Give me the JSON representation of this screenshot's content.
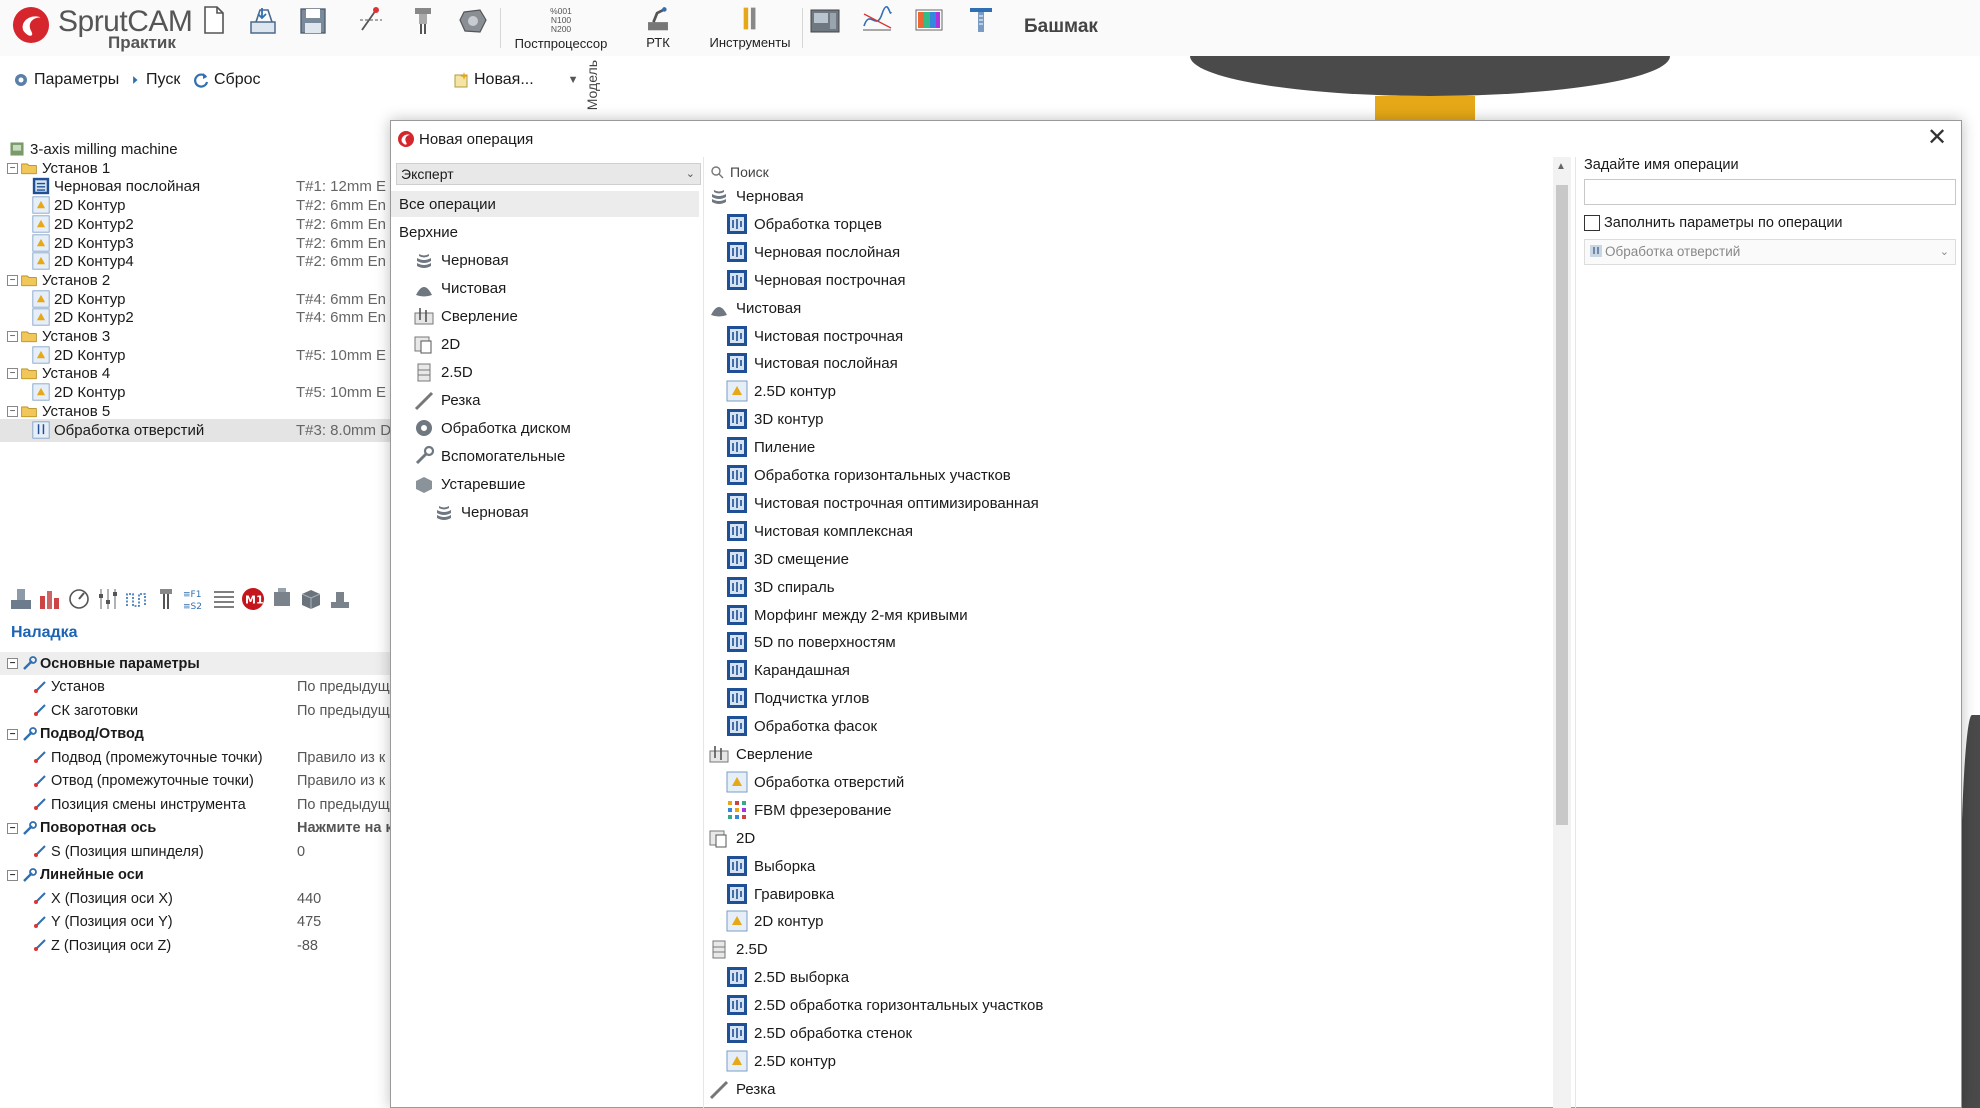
{
  "toolbar": {
    "logo_text": "SprutCAM",
    "logo_sub": "Практик",
    "buttons": [
      {
        "id": "new-file",
        "label": ""
      },
      {
        "id": "open-file",
        "label": ""
      },
      {
        "id": "save-file",
        "label": ""
      },
      {
        "id": "cut-tool",
        "label": ""
      },
      {
        "id": "tool-holder",
        "label": ""
      },
      {
        "id": "part",
        "label": ""
      },
      {
        "id": "postprocessor",
        "label": "Постпроцессор"
      },
      {
        "id": "rtk",
        "label": "РТК"
      },
      {
        "id": "tools",
        "label": "Инструменты"
      },
      {
        "id": "machine",
        "label": ""
      },
      {
        "id": "graph",
        "label": ""
      },
      {
        "id": "palette",
        "label": ""
      },
      {
        "id": "measure",
        "label": ""
      }
    ],
    "postprocessor_label": "Постпроцессор",
    "postprocessor_codes": [
      "%001",
      "N100",
      "N200"
    ],
    "rtk_label": "РТК",
    "tools_label": "Инструменты",
    "project_title": "Башмак"
  },
  "left_panel": {
    "actions": {
      "params": "Параметры",
      "run": "Пуск",
      "reset": "Сброс",
      "new": "Новая..."
    },
    "side_tab": "Модель",
    "tree": [
      {
        "level": 0,
        "type": "machine",
        "label": "3-axis milling machine",
        "tool": ""
      },
      {
        "level": 0,
        "type": "setup",
        "label": "Установ 1",
        "tool": ""
      },
      {
        "level": 1,
        "type": "op-rough",
        "label": "Черновая послойная",
        "tool": "T#1: 12mm E"
      },
      {
        "level": 1,
        "type": "op-2d",
        "label": "2D Контур",
        "tool": "T#2: 6mm En"
      },
      {
        "level": 1,
        "type": "op-2d",
        "label": "2D Контур2",
        "tool": "T#2: 6mm En"
      },
      {
        "level": 1,
        "type": "op-2d",
        "label": "2D Контур3",
        "tool": "T#2: 6mm En"
      },
      {
        "level": 1,
        "type": "op-2d",
        "label": "2D Контур4",
        "tool": "T#2: 6mm En"
      },
      {
        "level": 0,
        "type": "setup",
        "label": "Установ 2",
        "tool": ""
      },
      {
        "level": 1,
        "type": "op-2d",
        "label": "2D Контур",
        "tool": "T#4: 6mm En"
      },
      {
        "level": 1,
        "type": "op-2d",
        "label": "2D Контур2",
        "tool": "T#4: 6mm En"
      },
      {
        "level": 0,
        "type": "setup",
        "label": "Установ 3",
        "tool": ""
      },
      {
        "level": 1,
        "type": "op-2d",
        "label": "2D Контур",
        "tool": "T#5: 10mm E"
      },
      {
        "level": 0,
        "type": "setup",
        "label": "Установ 4",
        "tool": ""
      },
      {
        "level": 1,
        "type": "op-2d",
        "label": "2D Контур",
        "tool": "T#5: 10mm E"
      },
      {
        "level": 0,
        "type": "setup",
        "label": "Установ 5",
        "tool": ""
      },
      {
        "level": 1,
        "type": "op-drill",
        "label": "Обработка отверстий",
        "tool": "T#3: 8.0mm D",
        "selected": true
      }
    ],
    "props_header": "Наладка",
    "props": [
      {
        "group": true,
        "label": "Основные параметры",
        "value": ""
      },
      {
        "group": false,
        "label": "Установ",
        "value": "По предыдущ"
      },
      {
        "group": false,
        "label": "СК заготовки",
        "value": "По предыдущ"
      },
      {
        "group": true,
        "label": "Подвод/Отвод",
        "value": ""
      },
      {
        "group": false,
        "label": "Подвод (промежуточные точки)",
        "value": "Правило из к"
      },
      {
        "group": false,
        "label": "Отвод (промежуточные точки)",
        "value": "Правило из к"
      },
      {
        "group": false,
        "label": "Позиция смены инструмента",
        "value": "По предыдущ"
      },
      {
        "group": true,
        "label": "Поворотная ось",
        "value": "Нажмите на к"
      },
      {
        "group": false,
        "label": "S (Позиция шпинделя)",
        "value": "0"
      },
      {
        "group": true,
        "label": "Линейные оси",
        "value": ""
      },
      {
        "group": false,
        "label": "X (Позиция оси X)",
        "value": "440"
      },
      {
        "group": false,
        "label": "Y (Позиция оси Y)",
        "value": "475"
      },
      {
        "group": false,
        "label": "Z (Позиция оси Z)",
        "value": "-88"
      }
    ],
    "m1_badge": "M1"
  },
  "dialog": {
    "title": "Новая операция",
    "close": "✕",
    "mode_select": "Эксперт",
    "categories": [
      {
        "level": 0,
        "icon": "",
        "label": "Все операции",
        "selected": true
      },
      {
        "level": 0,
        "icon": "",
        "label": "Верхние"
      },
      {
        "level": 1,
        "icon": "rough",
        "label": "Черновая"
      },
      {
        "level": 1,
        "icon": "finish",
        "label": "Чистовая"
      },
      {
        "level": 1,
        "icon": "drill",
        "label": "Сверление"
      },
      {
        "level": 1,
        "icon": "2d",
        "label": "2D"
      },
      {
        "level": 1,
        "icon": "25d",
        "label": "2.5D"
      },
      {
        "level": 1,
        "icon": "cut",
        "label": "Резка"
      },
      {
        "level": 1,
        "icon": "disk",
        "label": "Обработка диском"
      },
      {
        "level": 1,
        "icon": "aux",
        "label": "Вспомогательные"
      },
      {
        "level": 1,
        "icon": "old",
        "label": "Устаревшие"
      },
      {
        "level": 2,
        "icon": "rough",
        "label": "Черновая"
      }
    ],
    "search_placeholder": "Поиск",
    "operations": [
      {
        "group": true,
        "icon": "rough",
        "label": "Черновая"
      },
      {
        "group": false,
        "icon": "op-blue",
        "label": "Обработка торцев"
      },
      {
        "group": false,
        "icon": "op-blue",
        "label": "Черновая послойная"
      },
      {
        "group": false,
        "icon": "op-blue",
        "label": "Черновая построчная"
      },
      {
        "group": true,
        "icon": "finish",
        "label": "Чистовая"
      },
      {
        "group": false,
        "icon": "op-blue",
        "label": "Чистовая построчная"
      },
      {
        "group": false,
        "icon": "op-blue",
        "label": "Чистовая послойная"
      },
      {
        "group": false,
        "icon": "op-light",
        "label": "2.5D контур"
      },
      {
        "group": false,
        "icon": "op-blue",
        "label": "3D контур"
      },
      {
        "group": false,
        "icon": "op-blue",
        "label": "Пиление"
      },
      {
        "group": false,
        "icon": "op-blue",
        "label": "Обработка горизонтальных участков"
      },
      {
        "group": false,
        "icon": "op-blue",
        "label": "Чистовая построчная оптимизированная"
      },
      {
        "group": false,
        "icon": "op-blue",
        "label": "Чистовая комплексная"
      },
      {
        "group": false,
        "icon": "op-blue",
        "label": "3D смещение"
      },
      {
        "group": false,
        "icon": "op-blue",
        "label": "3D спираль"
      },
      {
        "group": false,
        "icon": "op-blue",
        "label": "Морфинг между 2-мя кривыми"
      },
      {
        "group": false,
        "icon": "op-blue",
        "label": "5D по поверхностям"
      },
      {
        "group": false,
        "icon": "op-blue",
        "label": "Карандашная"
      },
      {
        "group": false,
        "icon": "op-blue",
        "label": "Подчистка углов"
      },
      {
        "group": false,
        "icon": "op-blue",
        "label": "Обработка фасок"
      },
      {
        "group": true,
        "icon": "drill",
        "label": "Сверление"
      },
      {
        "group": false,
        "icon": "op-light",
        "label": "Обработка отверстий"
      },
      {
        "group": false,
        "icon": "fbm",
        "label": "FBM фрезерование"
      },
      {
        "group": true,
        "icon": "2d",
        "label": "2D"
      },
      {
        "group": false,
        "icon": "op-blue",
        "label": "Выборка"
      },
      {
        "group": false,
        "icon": "op-blue",
        "label": "Гравировка"
      },
      {
        "group": false,
        "icon": "op-light",
        "label": "2D контур"
      },
      {
        "group": true,
        "icon": "25d",
        "label": "2.5D"
      },
      {
        "group": false,
        "icon": "op-blue",
        "label": "2.5D выборка"
      },
      {
        "group": false,
        "icon": "op-blue",
        "label": "2.5D обработка горизонтальных участков"
      },
      {
        "group": false,
        "icon": "op-blue",
        "label": "2.5D обработка стенок"
      },
      {
        "group": false,
        "icon": "op-light",
        "label": "2.5D контур"
      },
      {
        "group": true,
        "icon": "cut",
        "label": "Резка"
      }
    ],
    "name_label": "Задайте имя операции",
    "name_value": "",
    "fill_checkbox_label": "Заполнить параметры по операции",
    "fill_from": "Обработка отверстий"
  },
  "colors": {
    "accent_blue": "#1e64b4",
    "logo_red": "#d6262d",
    "selection": "#e4e4e4",
    "viewport_dark": "#4a4a4a",
    "viewport_gold": "#e6a817"
  }
}
